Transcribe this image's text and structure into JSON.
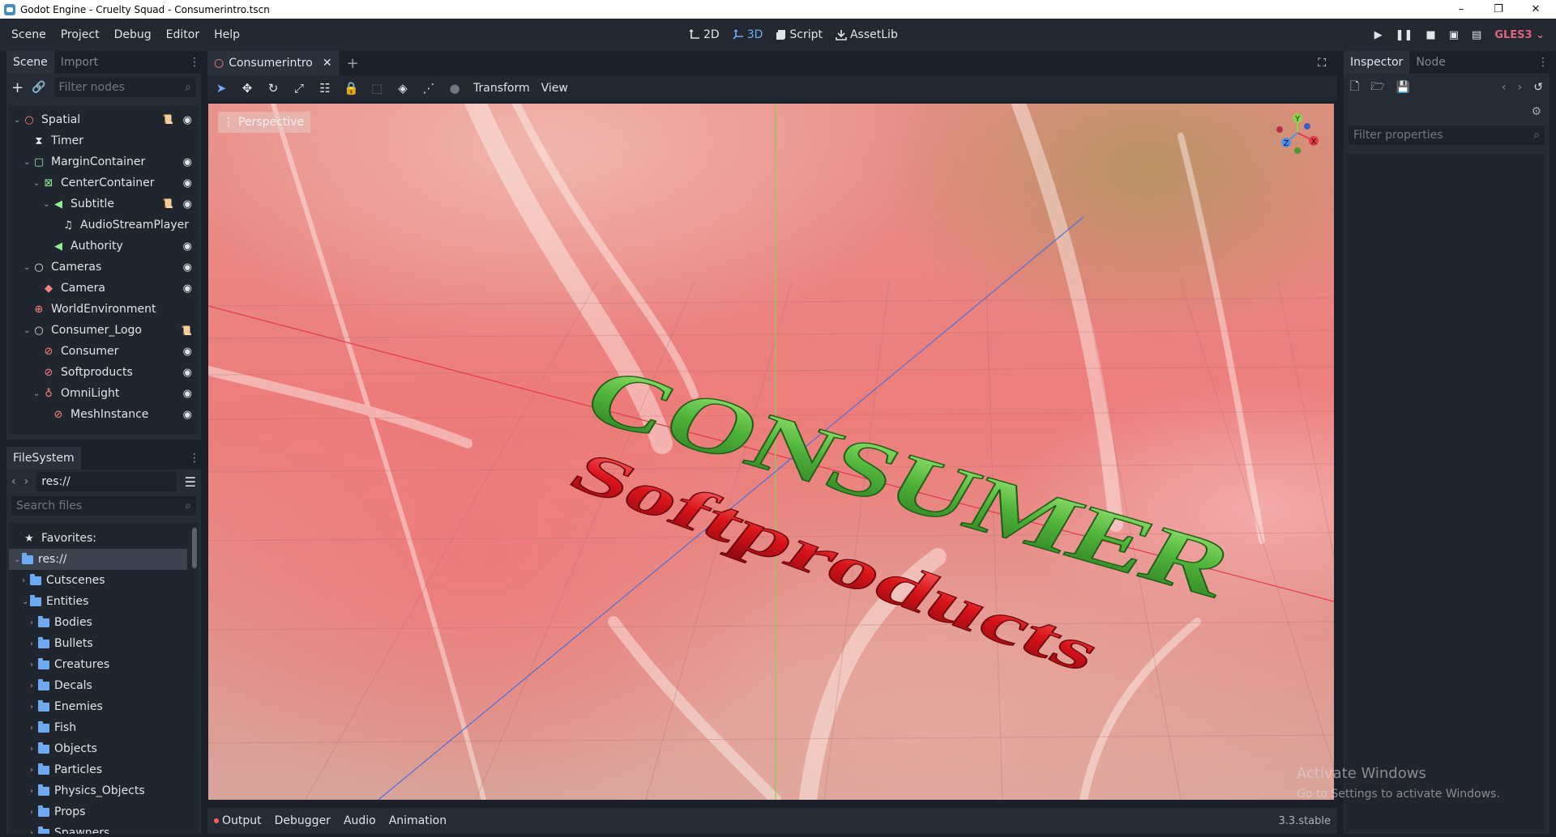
{
  "window": {
    "title": "Godot Engine - Cruelty Squad - Consumerintro.tscn",
    "controls": [
      "–",
      "❐",
      "✕"
    ]
  },
  "menus": [
    "Scene",
    "Project",
    "Debug",
    "Editor",
    "Help"
  ],
  "modes": [
    {
      "label": "2D",
      "icon": "2d-icon",
      "active": false
    },
    {
      "label": "3D",
      "icon": "3d-icon",
      "active": true
    },
    {
      "label": "Script",
      "icon": "script-icon",
      "active": false
    },
    {
      "label": "AssetLib",
      "icon": "assetlib-icon",
      "active": false
    }
  ],
  "renderer": "GLES3",
  "scene_dock": {
    "tabs": [
      "Scene",
      "Import"
    ],
    "filter_placeholder": "Filter nodes",
    "nodes": [
      {
        "label": "Spatial",
        "depth": 0,
        "arrow": "v",
        "icon": "spatial-icon",
        "color": "#ff8484",
        "script": true,
        "eye": true
      },
      {
        "label": "Timer",
        "depth": 1,
        "arrow": "",
        "icon": "timer-icon",
        "color": "#dfe3ea",
        "script": false,
        "eye": false
      },
      {
        "label": "MarginContainer",
        "depth": 1,
        "arrow": "v",
        "icon": "margin-container-icon",
        "color": "#8eef97",
        "script": false,
        "eye": true
      },
      {
        "label": "CenterContainer",
        "depth": 2,
        "arrow": "v",
        "icon": "center-container-icon",
        "color": "#8eef97",
        "script": false,
        "eye": true
      },
      {
        "label": "Subtitle",
        "depth": 3,
        "arrow": "v",
        "icon": "label-icon",
        "color": "#8eef97",
        "script": true,
        "eye": true
      },
      {
        "label": "AudioStreamPlayer",
        "depth": 4,
        "arrow": "",
        "icon": "audio-icon",
        "color": "#dfe3ea",
        "script": false,
        "eye": false
      },
      {
        "label": "Authority",
        "depth": 3,
        "arrow": "",
        "icon": "label-icon",
        "color": "#8eef97",
        "script": false,
        "eye": true
      },
      {
        "label": "Cameras",
        "depth": 1,
        "arrow": "v",
        "icon": "spatial-icon",
        "color": "#dfe3ea",
        "script": false,
        "eye": true
      },
      {
        "label": "Camera",
        "depth": 2,
        "arrow": "",
        "icon": "camera-icon",
        "color": "#ff8484",
        "script": false,
        "eye": true
      },
      {
        "label": "WorldEnvironment",
        "depth": 1,
        "arrow": "",
        "icon": "world-environment-icon",
        "color": "#ff8484",
        "script": false,
        "eye": false
      },
      {
        "label": "Consumer_Logo",
        "depth": 1,
        "arrow": "v",
        "icon": "spatial-icon",
        "color": "#dfe3ea",
        "script": true,
        "eye": false
      },
      {
        "label": "Consumer",
        "depth": 2,
        "arrow": "",
        "icon": "mesh-instance-icon",
        "color": "#ff8484",
        "script": false,
        "eye": true
      },
      {
        "label": "Softproducts",
        "depth": 2,
        "arrow": "",
        "icon": "mesh-instance-icon",
        "color": "#ff8484",
        "script": false,
        "eye": true
      },
      {
        "label": "OmniLight",
        "depth": 2,
        "arrow": "v",
        "icon": "omni-light-icon",
        "color": "#ff8484",
        "script": false,
        "eye": true
      },
      {
        "label": "MeshInstance",
        "depth": 3,
        "arrow": "",
        "icon": "mesh-instance-icon",
        "color": "#ff8484",
        "script": false,
        "eye": true
      }
    ]
  },
  "filesystem": {
    "tab": "FileSystem",
    "path": "res://",
    "search_placeholder": "Search files",
    "favorites_label": "Favorites:",
    "root": "res://",
    "folders": [
      {
        "label": "Cutscenes",
        "depth": 1,
        "arrow": ">"
      },
      {
        "label": "Entities",
        "depth": 1,
        "arrow": "v"
      },
      {
        "label": "Bodies",
        "depth": 2,
        "arrow": ">"
      },
      {
        "label": "Bullets",
        "depth": 2,
        "arrow": ">"
      },
      {
        "label": "Creatures",
        "depth": 2,
        "arrow": ">"
      },
      {
        "label": "Decals",
        "depth": 2,
        "arrow": ">"
      },
      {
        "label": "Enemies",
        "depth": 2,
        "arrow": ">"
      },
      {
        "label": "Fish",
        "depth": 2,
        "arrow": ">"
      },
      {
        "label": "Objects",
        "depth": 2,
        "arrow": ">"
      },
      {
        "label": "Particles",
        "depth": 2,
        "arrow": ">"
      },
      {
        "label": "Physics_Objects",
        "depth": 2,
        "arrow": ">"
      },
      {
        "label": "Props",
        "depth": 2,
        "arrow": ">"
      },
      {
        "label": "Spawners",
        "depth": 2,
        "arrow": ">"
      }
    ]
  },
  "editor_tabs": [
    {
      "label": "Consumerintro",
      "active": true
    }
  ],
  "viewport": {
    "toolbar_menus": [
      "Transform",
      "View"
    ],
    "perspective_label": "Perspective",
    "logo_word_1": "CONSUMER",
    "logo_word_2": "Softproducts",
    "gizmo_axes": [
      "Y",
      "X",
      "Z"
    ]
  },
  "bottom_tabs": [
    "Output",
    "Debugger",
    "Audio",
    "Animation"
  ],
  "version": "3.3.stable",
  "inspector": {
    "tabs": [
      "Inspector",
      "Node"
    ],
    "filter_placeholder": "Filter properties"
  },
  "watermark": {
    "title": "Activate Windows",
    "subtitle": "Go to Settings to activate Windows."
  }
}
